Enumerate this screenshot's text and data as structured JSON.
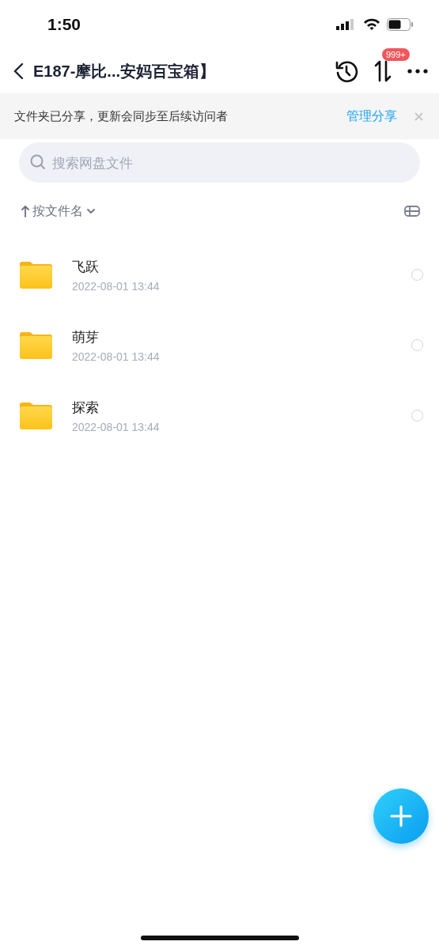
{
  "status_bar": {
    "time": "1:50"
  },
  "nav": {
    "title": "E187-摩比...安妈百宝箱】",
    "badge": "999+"
  },
  "banner": {
    "text": "文件夹已分享，更新会同步至后续访问者",
    "link": "管理分享"
  },
  "search": {
    "placeholder": "搜索网盘文件"
  },
  "sort": {
    "label": "按文件名"
  },
  "files": [
    {
      "name": "飞跃",
      "date": "2022-08-01 13:44",
      "selected": false
    },
    {
      "name": "萌芽",
      "date": "2022-08-01 13:44",
      "selected": false
    },
    {
      "name": "探索",
      "date": "2022-08-01 13:44",
      "selected": false
    }
  ]
}
